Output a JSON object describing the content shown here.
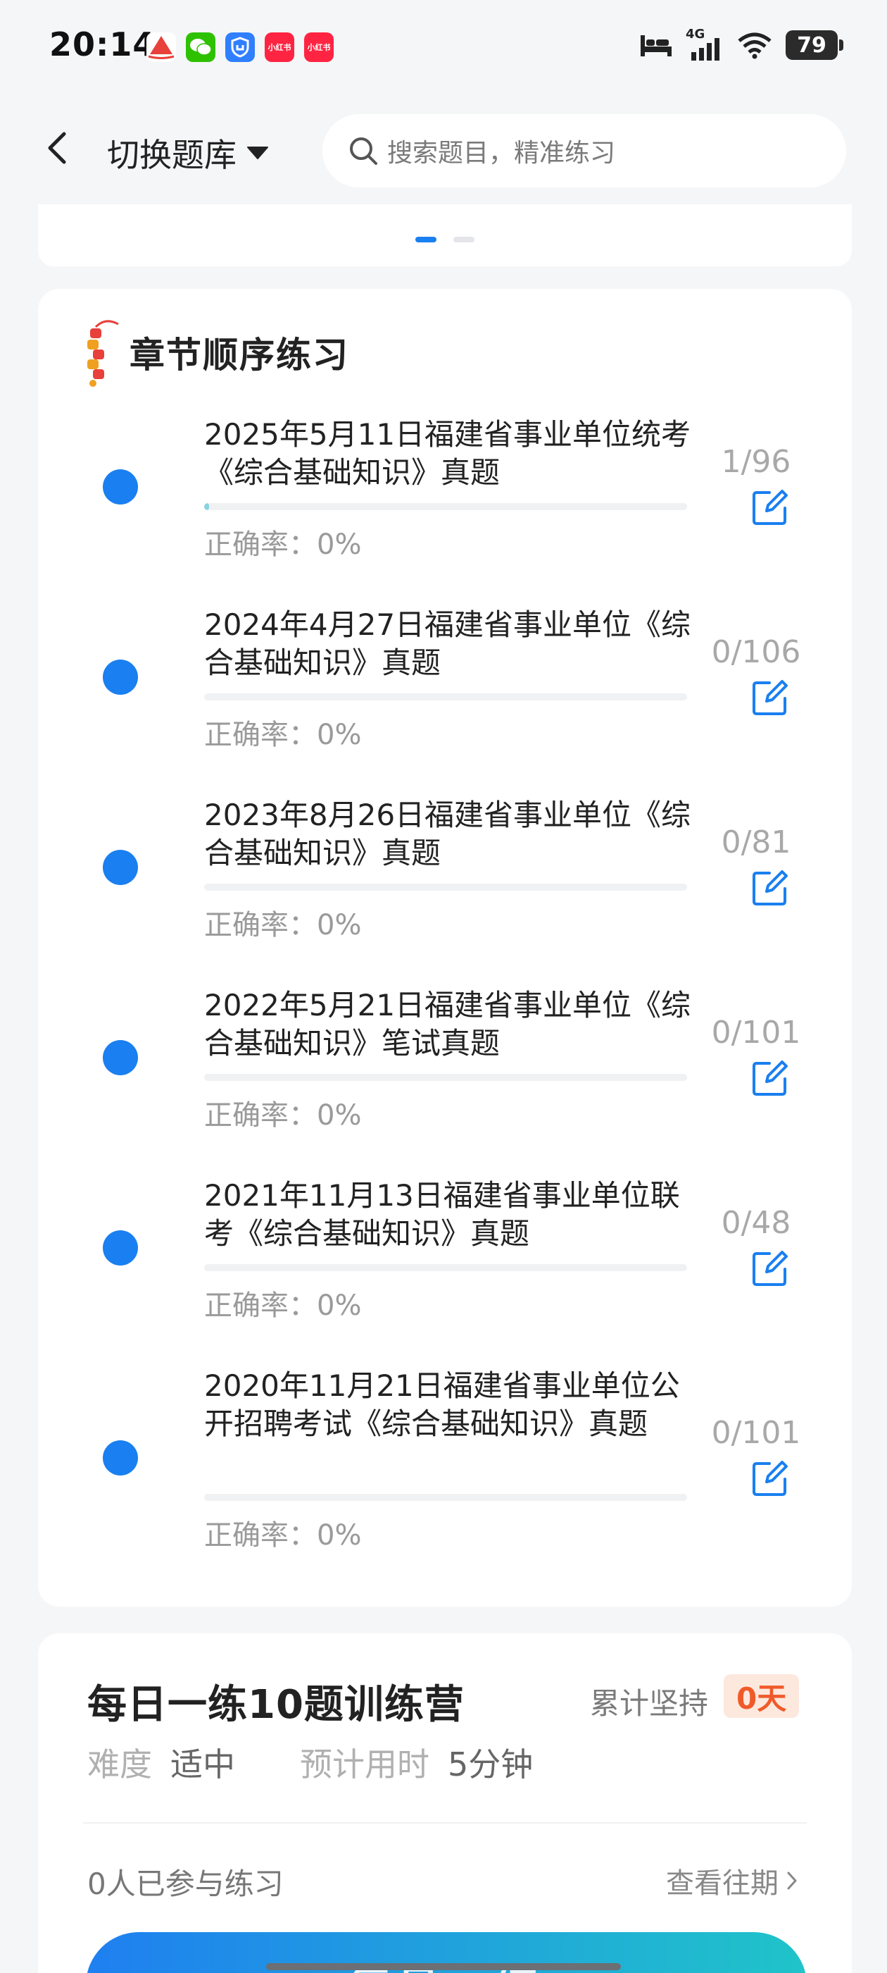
{
  "status_bar": {
    "time": "20:14",
    "notifications": [
      {
        "name": "sail-app-icon",
        "color": "#ffffff"
      },
      {
        "name": "wechat-icon",
        "color": "#2dc100"
      },
      {
        "name": "shield-app-icon",
        "color": "#2f7fff"
      },
      {
        "name": "xiaohongshu-icon",
        "color": "#ff2442",
        "text": "小红书"
      },
      {
        "name": "xiaohongshu-icon",
        "color": "#ff2442",
        "text": "小红书"
      }
    ],
    "network": "4G",
    "battery": "79"
  },
  "header": {
    "switch_label": "切换题库",
    "search_placeholder": "搜索题目，精准练习"
  },
  "chapter": {
    "title": "章节顺序练习",
    "items": [
      {
        "title": "2025年5月11日福建省事业单位统考《综合基础知识》真题",
        "count": "1/96",
        "done": 1,
        "total": 96,
        "accuracy": "正确率：0%"
      },
      {
        "title": "2024年4月27日福建省事业单位《综合基础知识》真题",
        "count": "0/106",
        "done": 0,
        "total": 106,
        "accuracy": "正确率：0%"
      },
      {
        "title": "2023年8月26日福建省事业单位《综合基础知识》真题",
        "count": "0/81",
        "done": 0,
        "total": 81,
        "accuracy": "正确率：0%"
      },
      {
        "title": "2022年5月21日福建省事业单位《综合基础知识》笔试真题",
        "count": "0/101",
        "done": 0,
        "total": 101,
        "accuracy": "正确率：0%"
      },
      {
        "title": "2021年11月13日福建省事业单位联考《综合基础知识》真题",
        "count": "0/48",
        "done": 0,
        "total": 48,
        "accuracy": "正确率：0%"
      },
      {
        "title": "2020年11月21日福建省事业单位公开招聘考试《综合基础知识》真题",
        "count": "0/101",
        "done": 0,
        "total": 101,
        "accuracy": "正确率：0%"
      }
    ]
  },
  "daily": {
    "title": "每日一练10题训练营",
    "streak_label": "累计坚持",
    "streak_value": "0天",
    "difficulty_key": "难度",
    "difficulty_val": "适中",
    "time_key": "预计用时",
    "time_val": "5分钟",
    "participants": "0人已参与练习",
    "history_link": "查看往期",
    "start_button": "每日一练"
  },
  "colors": {
    "accent": "#1a7ff0",
    "streak": "#f05a2a",
    "button_gradient_end": "#20c4c9"
  }
}
